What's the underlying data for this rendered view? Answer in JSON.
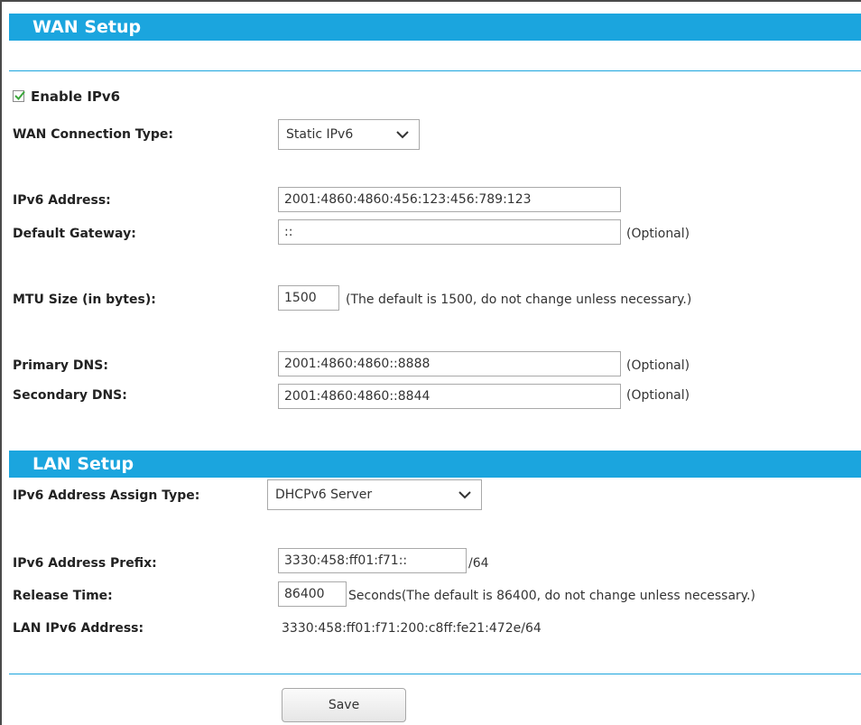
{
  "wan": {
    "title": "WAN Setup",
    "enable_ipv6_label": "Enable IPv6",
    "enable_ipv6_checked": true,
    "connection_type_label": "WAN Connection Type:",
    "connection_type_value": "Static IPv6",
    "ipv6_address_label": "IPv6 Address:",
    "ipv6_address_value": "2001:4860:4860:456:123:456:789:123",
    "default_gateway_label": "Default Gateway:",
    "default_gateway_value": "::",
    "default_gateway_note": "(Optional)",
    "mtu_label": "MTU Size (in bytes):",
    "mtu_value": "1500",
    "mtu_note": "(The default is 1500, do not change unless necessary.)",
    "primary_dns_label": "Primary DNS:",
    "primary_dns_value": "2001:4860:4860::8888",
    "primary_dns_note": "(Optional)",
    "secondary_dns_label": "Secondary DNS:",
    "secondary_dns_value": "2001:4860:4860::8844",
    "secondary_dns_note": "(Optional)"
  },
  "lan": {
    "title": "LAN Setup",
    "assign_type_label": "IPv6 Address Assign Type:",
    "assign_type_value": "DHCPv6 Server",
    "prefix_label": "IPv6 Address Prefix:",
    "prefix_value": "3330:458:ff01:f71::",
    "prefix_suffix": "/64",
    "release_time_label": "Release Time:",
    "release_time_value": "86400",
    "release_time_note": "Seconds(The default is 86400, do not change unless necessary.)",
    "lan_ipv6_label": "LAN IPv6 Address:",
    "lan_ipv6_value": "3330:458:ff01:f71:200:c8ff:fe21:472e/64"
  },
  "actions": {
    "save_label": "Save"
  },
  "colors": {
    "header_bg": "#1ba5de",
    "checkmark": "#3aa63a"
  },
  "icons": {
    "dropdown": "chevron-down-icon",
    "checkbox": "checkmark-icon"
  }
}
